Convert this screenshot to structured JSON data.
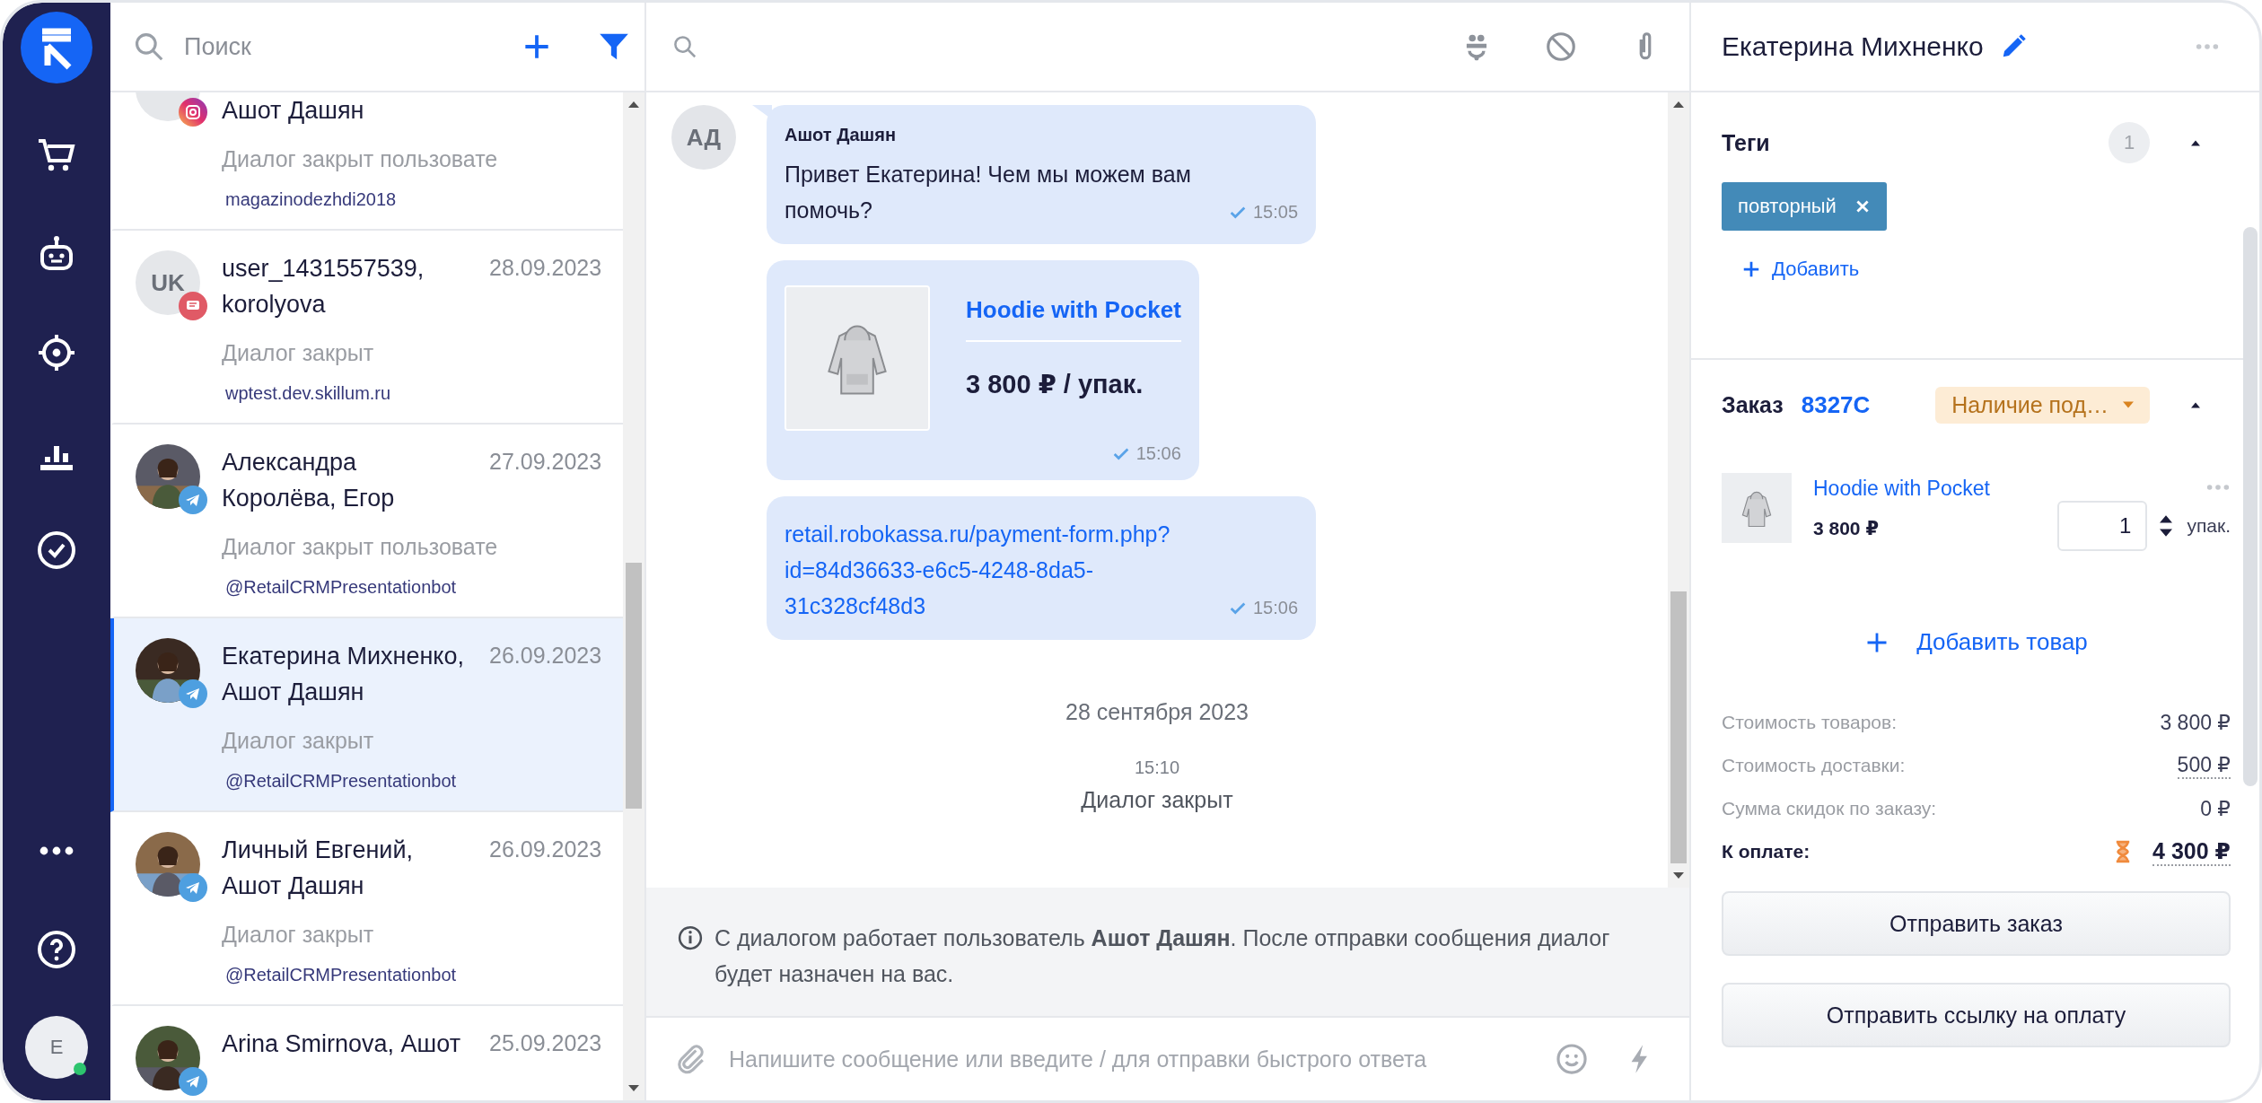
{
  "nav": {
    "user": {
      "initial": "E",
      "online": true
    }
  },
  "chat_list": {
    "search": {
      "placeholder": "Поиск"
    },
    "chats": [
      {
        "name": "Ашот Дашян",
        "preview": "Диалог закрыт пользовате",
        "channel": {
          "kind": "instagram",
          "name": "magazinodezhdi2018"
        },
        "avatar": {
          "kind": "initials"
        },
        "selected": false
      },
      {
        "name": "user_1431557539, korolyova",
        "date": "28.09.2023",
        "preview": "Диалог закрыт",
        "channel": {
          "kind": "chat",
          "name": "wptest.dev.skillum.ru"
        },
        "avatar": {
          "kind": "initials",
          "text": "UK"
        },
        "selected": false
      },
      {
        "name": "Александра Королёва, Егор",
        "date": "27.09.2023",
        "preview": "Диалог закрыт пользовате",
        "channel": {
          "kind": "telegram",
          "name": "@RetailCRMPresentationbot"
        },
        "selected": false
      },
      {
        "name": "Екатерина Михненко, Ашот Дашян",
        "date": "26.09.2023",
        "preview": "Диалог закрыт",
        "channel": {
          "kind": "telegram",
          "name": "@RetailCRMPresentationbot"
        },
        "selected": true
      },
      {
        "name": "Личный Евгений, Ашот Дашян",
        "date": "26.09.2023",
        "preview": "Диалог закрыт",
        "channel": {
          "kind": "telegram",
          "name": "@RetailCRMPresentationbot"
        },
        "selected": false
      },
      {
        "name": "Arina Smirnova, Ашот",
        "date": "25.09.2023",
        "channel": {
          "kind": "telegram"
        },
        "selected": false
      }
    ]
  },
  "chat": {
    "messages": [
      {
        "kind": "text",
        "avatar": "АД",
        "author": "Ашот Дашян",
        "text": "Привет Екатерина! Чем мы можем вам помочь?",
        "time": "15:05",
        "read": true
      },
      {
        "kind": "product",
        "title": "Hoodie with Pocket",
        "price": "3 800 ₽ / упак.",
        "time": "15:06",
        "read": true
      },
      {
        "kind": "link",
        "text": "retail.robokassa.ru/payment-form.php?id=84d36633-e6c5-4248-8da5-31c328cf48d3",
        "time": "15:06",
        "read": true
      }
    ],
    "events": [
      {
        "kind": "date",
        "text": "28 сентября 2023"
      },
      {
        "kind": "time",
        "text": "15:10"
      },
      {
        "kind": "status",
        "text": "Диалог закрыт"
      }
    ],
    "notice": "С диалогом работает пользователь **Ашот Дашян**. После отправки сообщения диалог будет назначен на вас.",
    "composer": {
      "placeholder": "Напишите сообщение или введите / для отправки быстрого ответа"
    }
  },
  "contact": {
    "name": "Екатерина Михненко"
  },
  "tags": {
    "title": "Теги",
    "count": "1",
    "expanded": true,
    "items": [
      {
        "label": "повторный"
      }
    ],
    "add_label": "Добавить"
  },
  "order": {
    "title": "Заказ",
    "number": "8327C",
    "status": "Наличие под…",
    "expanded": true,
    "items": [
      {
        "name": "Hoodie with Pocket",
        "price": "3 800 ₽",
        "quantity": "1",
        "unit": "упак."
      }
    ],
    "add_label": "Добавить товар",
    "totals": [
      {
        "kind": "plain",
        "label": "Стоимость товаров:",
        "value": "3 800 ₽"
      },
      {
        "kind": "dotted",
        "label": "Стоимость доставки:",
        "value": "500 ₽"
      },
      {
        "kind": "plain",
        "label": "Сумма скидок по заказу:",
        "value": "0 ₽"
      },
      {
        "kind": "total",
        "label": "К оплате:",
        "value": "4 300 ₽"
      }
    ],
    "buttons": [
      "Отправить заказ",
      "Отправить ссылку на оплату"
    ]
  }
}
